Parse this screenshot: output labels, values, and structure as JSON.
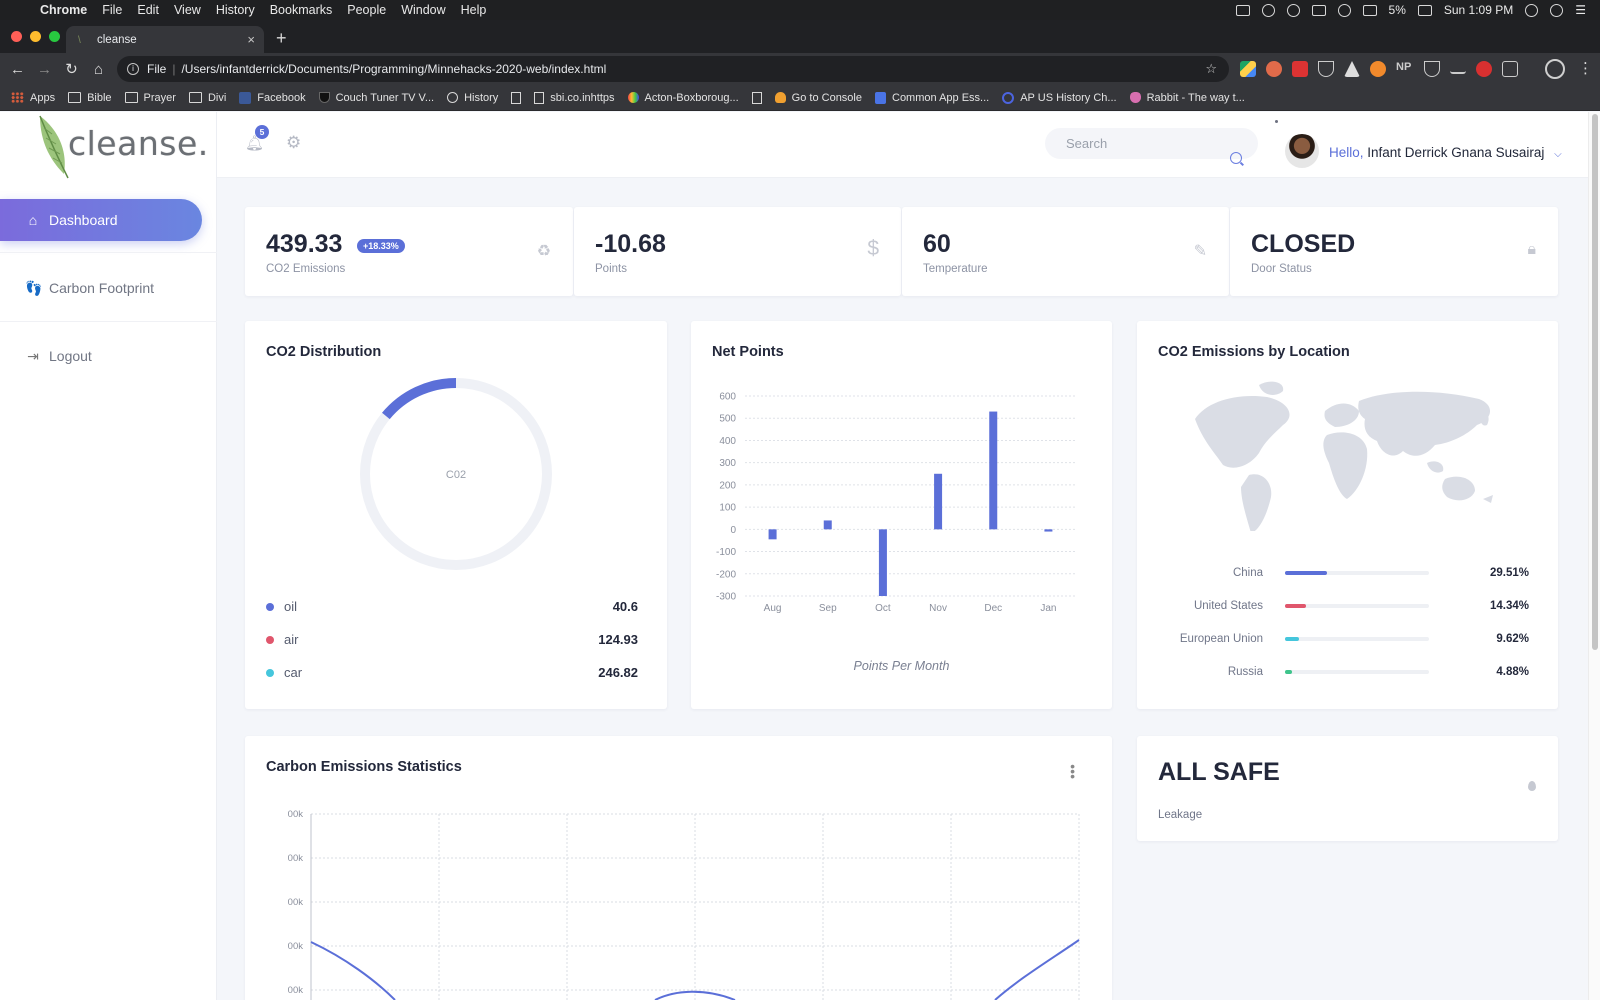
{
  "menubar": {
    "app": "Chrome",
    "items": [
      "File",
      "Edit",
      "View",
      "History",
      "Bookmarks",
      "People",
      "Window",
      "Help"
    ],
    "battery": "5%",
    "clock": "Sun 1:09 PM"
  },
  "browser": {
    "tab_title": "cleanse",
    "url_scheme": "File",
    "url": "/Users/infantderrick/Documents/Programming/Minnehacks-2020-web/index.html",
    "bookmarks": [
      {
        "label": "Apps",
        "icon": "grid"
      },
      {
        "label": "Bible",
        "icon": "folder"
      },
      {
        "label": "Prayer",
        "icon": "folder"
      },
      {
        "label": "Divi",
        "icon": "folder"
      },
      {
        "label": "Facebook",
        "icon": "fb"
      },
      {
        "label": "Couch Tuner TV V...",
        "icon": "shield"
      },
      {
        "label": "History",
        "icon": "clock"
      },
      {
        "label": "",
        "icon": "doc"
      },
      {
        "label": "sbi.co.inhttps",
        "icon": "doc"
      },
      {
        "label": "Acton-Boxboroug...",
        "icon": "rainbow"
      },
      {
        "label": "",
        "icon": "doc"
      },
      {
        "label": "Go to Console",
        "icon": "orange"
      },
      {
        "label": "Common App Ess...",
        "icon": "blue"
      },
      {
        "label": "AP US History Ch...",
        "icon": "g"
      },
      {
        "label": "Rabbit - The way t...",
        "icon": "rabbit"
      }
    ]
  },
  "sidebar": {
    "logo_text": "cleanse.",
    "items": [
      {
        "label": "Dashboard",
        "icon": "home-icon"
      },
      {
        "label": "Carbon Footprint",
        "icon": "footprint-icon"
      },
      {
        "label": "Logout",
        "icon": "logout-icon"
      }
    ]
  },
  "header": {
    "notification_count": "5",
    "search_placeholder": "Search",
    "greeting": "Hello,",
    "user_name": "Infant Derrick Gnana Susairaj"
  },
  "stats": [
    {
      "value": "439.33",
      "label": "CO2 Emissions",
      "badge": "+18.33%",
      "icon": "recycle-icon"
    },
    {
      "value": "-10.68",
      "label": "Points",
      "icon": "dollar-icon"
    },
    {
      "value": "60",
      "label": "Temperature",
      "icon": "pencil-icon"
    },
    {
      "value": "CLOSED",
      "label": "Door Status",
      "icon": "lock-icon"
    }
  ],
  "co2_distribution": {
    "title": "CO2 Distribution",
    "center_label": "C02",
    "items": [
      {
        "label": "oil",
        "value": "40.6",
        "color": "#5b6fd8"
      },
      {
        "label": "air",
        "value": "124.93",
        "color": "#e0566c"
      },
      {
        "label": "car",
        "value": "246.82",
        "color": "#45c6dc"
      }
    ],
    "arc_fraction": 0.14
  },
  "net_points": {
    "title": "Net Points",
    "caption": "Points Per Month"
  },
  "co2_location": {
    "title": "CO2 Emissions by Location",
    "rows": [
      {
        "country": "China",
        "pct": "29.51%",
        "fraction": 0.2951,
        "color": "#5b6fd8"
      },
      {
        "country": "United States",
        "pct": "14.34%",
        "fraction": 0.1434,
        "color": "#e0566c"
      },
      {
        "country": "European Union",
        "pct": "9.62%",
        "fraction": 0.0962,
        "color": "#45c6dc"
      },
      {
        "country": "Russia",
        "pct": "4.88%",
        "fraction": 0.0488,
        "color": "#3ec48b"
      }
    ]
  },
  "emissions_stats": {
    "title": "Carbon Emissions Statistics",
    "y_tick_labels": [
      "00k",
      "00k",
      "00k",
      "00k",
      "00k"
    ]
  },
  "safe": {
    "title": "ALL SAFE",
    "label": "Leakage"
  },
  "chart_data": {
    "type": "bar",
    "title": "Net Points",
    "xlabel": "Points Per Month",
    "ylabel": "",
    "categories": [
      "Aug",
      "Sep",
      "Oct",
      "Nov",
      "Dec",
      "Jan"
    ],
    "values": [
      -45,
      40,
      -300,
      250,
      530,
      -10
    ],
    "ylim": [
      -300,
      600
    ],
    "yticks": [
      600,
      500,
      400,
      300,
      200,
      100,
      0,
      -100,
      -200,
      -300
    ],
    "color": "#5b6fd8",
    "grid": true
  }
}
